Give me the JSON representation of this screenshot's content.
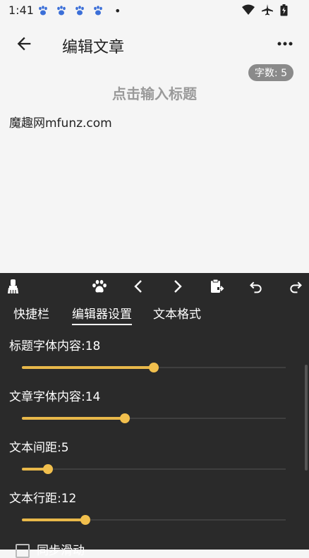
{
  "status": {
    "time": "1:41",
    "dot": "•"
  },
  "appbar": {
    "title": "编辑文章",
    "back_icon": "arrow-left-icon",
    "more_icon": "more-dots-icon"
  },
  "editor": {
    "word_count": "字数: 5",
    "title_placeholder": "点击输入标题",
    "content": "魔趣网mfunz.com"
  },
  "toolbar": {
    "icons": [
      "brush-icon",
      "paw-icon",
      "chevron-left-icon",
      "chevron-right-icon",
      "clipboard-paste-icon",
      "undo-icon",
      "redo-icon"
    ]
  },
  "tabs": [
    {
      "label": "快捷栏",
      "active": false
    },
    {
      "label": "编辑器设置",
      "active": true
    },
    {
      "label": "文本格式",
      "active": false
    }
  ],
  "settings": [
    {
      "label": "标题字体内容:18",
      "fraction": 0.5
    },
    {
      "label": "文章字体内容:14",
      "fraction": 0.39
    },
    {
      "label": "文本间距:5",
      "fraction": 0.1
    },
    {
      "label": "文本行距:12",
      "fraction": 0.24
    }
  ],
  "sync_scroll": {
    "label": "同步滑动",
    "checked": false
  },
  "colors": {
    "accent": "#f1bf4d",
    "panel_bg": "#2a2a2a",
    "page_bg": "#f5f5f5",
    "badge_bg": "#8a8a8a"
  }
}
